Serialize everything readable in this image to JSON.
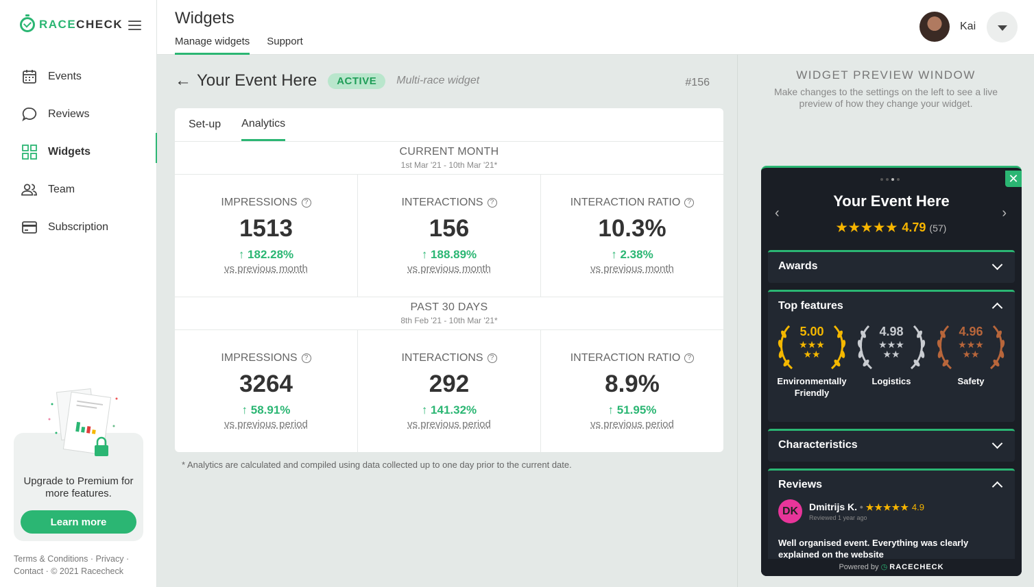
{
  "brand": {
    "name_a": "RACE",
    "name_b": "CHECK"
  },
  "sidebar": {
    "items": [
      {
        "label": "Events",
        "icon": "calendar-icon"
      },
      {
        "label": "Reviews",
        "icon": "chat-bubble-icon"
      },
      {
        "label": "Widgets",
        "icon": "grid-icon",
        "active": true
      },
      {
        "label": "Team",
        "icon": "people-icon"
      },
      {
        "label": "Subscription",
        "icon": "credit-card-icon"
      }
    ],
    "upgrade_text": "Upgrade to Premium for more features.",
    "learn_more": "Learn more",
    "footer": {
      "terms": "Terms & Conditions",
      "privacy": "Privacy",
      "contact": "Contact",
      "copyright": "© 2021 Racecheck"
    }
  },
  "header": {
    "title": "Widgets",
    "tabs": [
      "Manage widgets",
      "Support"
    ],
    "user_name": "Kai"
  },
  "event": {
    "title": "Your Event Here",
    "status": "ACTIVE",
    "subtitle": "Multi-race widget",
    "id": "#156"
  },
  "card_tabs": [
    "Set-up",
    "Analytics"
  ],
  "periods": [
    {
      "label": "CURRENT MONTH",
      "range": "1st Mar '21 - 10th Mar '21*",
      "stats": [
        {
          "label": "IMPRESSIONS",
          "value": "1513",
          "change": "↑ 182.28%",
          "vs": "vs previous month"
        },
        {
          "label": "INTERACTIONS",
          "value": "156",
          "change": "↑ 188.89%",
          "vs": "vs previous month"
        },
        {
          "label": "INTERACTION RATIO",
          "value": "10.3%",
          "change": "↑ 2.38%",
          "vs": "vs previous month"
        }
      ]
    },
    {
      "label": "PAST 30 DAYS",
      "range": "8th Feb '21 - 10th Mar '21*",
      "stats": [
        {
          "label": "IMPRESSIONS",
          "value": "3264",
          "change": "↑ 58.91%",
          "vs": "vs previous period"
        },
        {
          "label": "INTERACTIONS",
          "value": "292",
          "change": "↑ 141.32%",
          "vs": "vs previous period"
        },
        {
          "label": "INTERACTION RATIO",
          "value": "8.9%",
          "change": "↑ 51.95%",
          "vs": "vs previous period"
        }
      ]
    }
  ],
  "footnote": "* Analytics are calculated and compiled using data collected up to one day prior to the current date.",
  "preview": {
    "title": "WIDGET PREVIEW WINDOW",
    "description": "Make changes to the settings on the left to see a live preview of how they change your widget.",
    "widget": {
      "event_title": "Your Event Here",
      "stars": "★★★★★",
      "rating": "4.79",
      "count": "(57)",
      "sections": {
        "awards": "Awards",
        "top_features": "Top features",
        "characteristics": "Characteristics",
        "reviews": "Reviews"
      },
      "features": [
        {
          "score": "5.00",
          "label": "Environmentally Friendly",
          "color": "#f5b800"
        },
        {
          "score": "4.98",
          "label": "Logistics",
          "color": "#c9ccd1"
        },
        {
          "score": "4.96",
          "label": "Safety",
          "color": "#b8663b"
        }
      ],
      "review": {
        "initials": "DK",
        "name": "Dmitrijs K.",
        "stars": "★★★★★",
        "score": "4.9",
        "when": "Reviewed 1 year ago",
        "text": "Well organised event. Everything was clearly explained on the website"
      },
      "powered_by": "Powered by",
      "powered_brand": "RACECHECK"
    }
  },
  "colors": {
    "accent": "#2bb673",
    "star": "#f7b500",
    "widget_bg": "#1a1e25"
  }
}
